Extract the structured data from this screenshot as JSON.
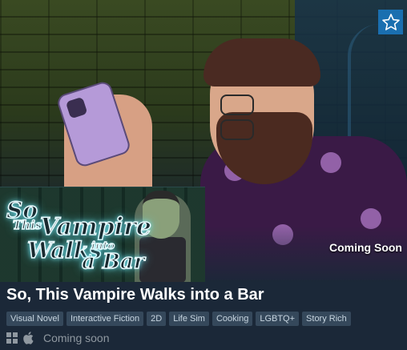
{
  "game": {
    "title": "So, This Vampire Walks into a Bar",
    "status_badge": "Coming Soon",
    "release_text": "Coming soon",
    "tags": [
      "Visual Novel",
      "Interactive Fiction",
      "2D",
      "Life Sim",
      "Cooking",
      "LGBTQ+",
      "Story Rich"
    ],
    "platforms": [
      "windows-icon",
      "apple-icon"
    ]
  },
  "capsule_logo": {
    "line1": "So",
    "line2": "This",
    "line3": "Vampire",
    "line4": "Walks",
    "line5": "into",
    "line6": "a Bar"
  },
  "wishlist": {
    "icon": "star-icon",
    "color": "#1a6fb0"
  },
  "colors": {
    "background": "#1b2838",
    "tag_bg": "#35485b",
    "tag_text": "#c7d5e0",
    "muted": "#8f98a0"
  }
}
